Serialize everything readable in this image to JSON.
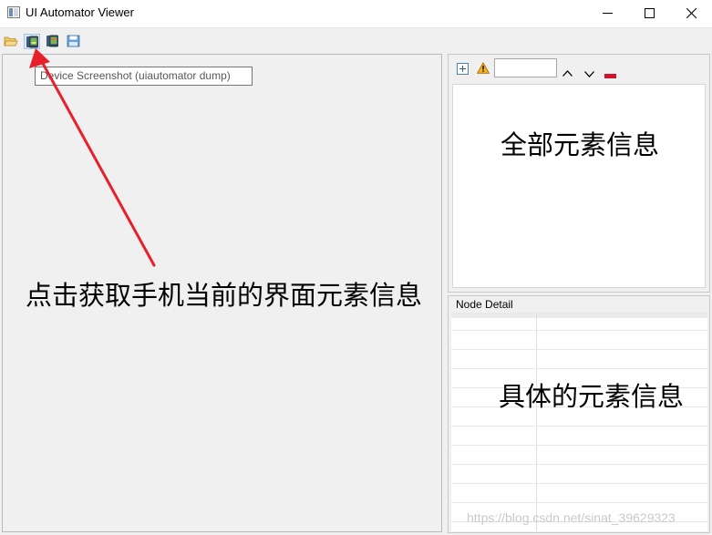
{
  "window": {
    "title": "UI Automator Viewer",
    "controls": [
      "minimize-icon",
      "maximize-icon",
      "close-icon"
    ]
  },
  "toolbar": {
    "buttons": [
      {
        "icon": "open-folder-icon",
        "state": "normal"
      },
      {
        "icon": "device-screenshot-icon",
        "state": "hovered"
      },
      {
        "icon": "device-screenshot-compressed-icon",
        "state": "normal"
      },
      {
        "icon": "save-icon",
        "state": "normal"
      }
    ],
    "tooltip": "Device Screenshot (uiautomator dump)"
  },
  "tree_panel": {
    "tools": [
      "expand-all-icon",
      "warning-icon",
      "filter-input",
      "previous-icon",
      "next-icon",
      "clear-icon"
    ],
    "filter_value": ""
  },
  "node_detail": {
    "label": "Node Detail"
  },
  "annotations": {
    "capture": "点击获取手机当前的界面元素信息",
    "tree": "全部元素信息",
    "detail": "具体的元素信息",
    "arrow_color": "#e8202a"
  },
  "watermark": "https://blog.csdn.net/sinat_39629323"
}
